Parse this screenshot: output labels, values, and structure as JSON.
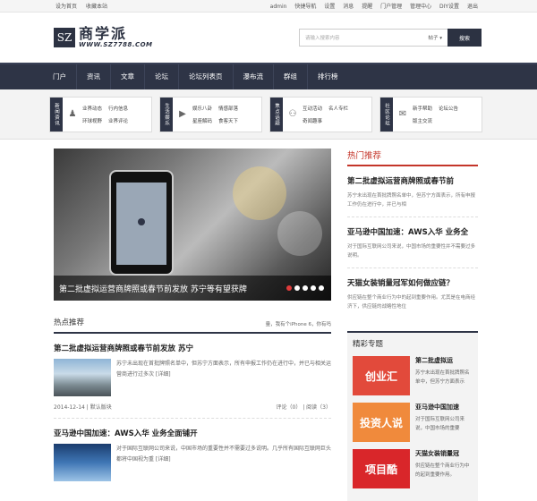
{
  "topbar": {
    "left": [
      "设为首页",
      "收藏本站"
    ],
    "right": [
      "admin",
      "快捷导航",
      "设置",
      "消息",
      "提醒",
      "门户管理",
      "管理中心",
      "DIY设置",
      "退出"
    ]
  },
  "logo": {
    "box": "SZ",
    "name": "商学派",
    "url": "WWW.SZ7788.COM"
  },
  "search": {
    "placeholder": "请输入搜索内容",
    "category": "帖子",
    "button": "搜索"
  },
  "nav": [
    "门户",
    "资讯",
    "文章",
    "论坛",
    "论坛列表页",
    "瀑布流",
    "群组",
    "排行榜"
  ],
  "categories": [
    {
      "title": "新闻资讯",
      "icon": "person-icon",
      "links": [
        "业界动态",
        "行内信息",
        "环球视野",
        "业界评论"
      ]
    },
    {
      "title": "生活娱乐",
      "icon": "video-icon",
      "links": [
        "娱乐八卦",
        "情感部落",
        "星座解码",
        "食客天下"
      ]
    },
    {
      "title": "焦点话题",
      "icon": "group-icon",
      "links": [
        "互动活动",
        "名人专栏",
        "奇闻趣事",
        ""
      ]
    },
    {
      "title": "社区论坛",
      "icon": "chat-icon",
      "links": [
        "新手帮助",
        "论坛公告",
        "版主交流",
        ""
      ]
    }
  ],
  "slider": {
    "caption": "第二批虚拟运营商牌照或春节前发放 苏宁等有望获牌",
    "dots": 5,
    "active": 0
  },
  "hot_section": {
    "title": "热点推荐",
    "more": "量，我有个iPhone 6，你有吗"
  },
  "articles": [
    {
      "title": "第二批虚拟运营商牌照或春节前发放 苏宁",
      "excerpt": "苏宁未出现在首批牌照名单中，但苏宁方面表示，所有申报工作仍在进行中，并已与相关运营商进行过多次 [详细]",
      "date": "2014-12-14",
      "category": "默认版块",
      "comments": "评论（0）",
      "reads": "阅读（3）"
    },
    {
      "title": "亚马逊中国加速：AWS入华 业务全面铺开",
      "excerpt": "对于国际互联网公司来说，中国市场的重要性并不需要过多说明。几乎所有国际互联网巨头都将中国视为重 [详细]"
    }
  ],
  "right": {
    "hot_title": "热门推荐",
    "hot": [
      {
        "title": "第二批虚拟运营商牌照或春节前",
        "excerpt": "苏宁未出现在首批牌照名单中，但苏宁方面表示，所有申报工作仍在进行中，并已与相"
      },
      {
        "title": "亚马逊中国加速：AWS入华 业务全",
        "excerpt": "对于国际互联网公司来说，中国市场的重要性并不需要过多说明。"
      },
      {
        "title": "天猫女装销量冠军如何做应链？",
        "excerpt": "供应链在整个商业行为中的起到重要作用。尤其是在电商经济下，供应链的战略性地位"
      }
    ],
    "topics_title": "精彩专题",
    "topics": [
      {
        "img": "创业汇",
        "title": "第二批虚拟运",
        "excerpt": "苏宁未出现在首批牌照名单中，但苏宁方面表示"
      },
      {
        "img": "投资人说",
        "title": "亚马逊中国加速",
        "excerpt": "对于国际互联网公司来说，中国市场的重要"
      },
      {
        "img": "项目酷",
        "title": "天猫女装销量冠",
        "excerpt": "供应链在整个商业行为中的起到重要作用。"
      }
    ]
  }
}
